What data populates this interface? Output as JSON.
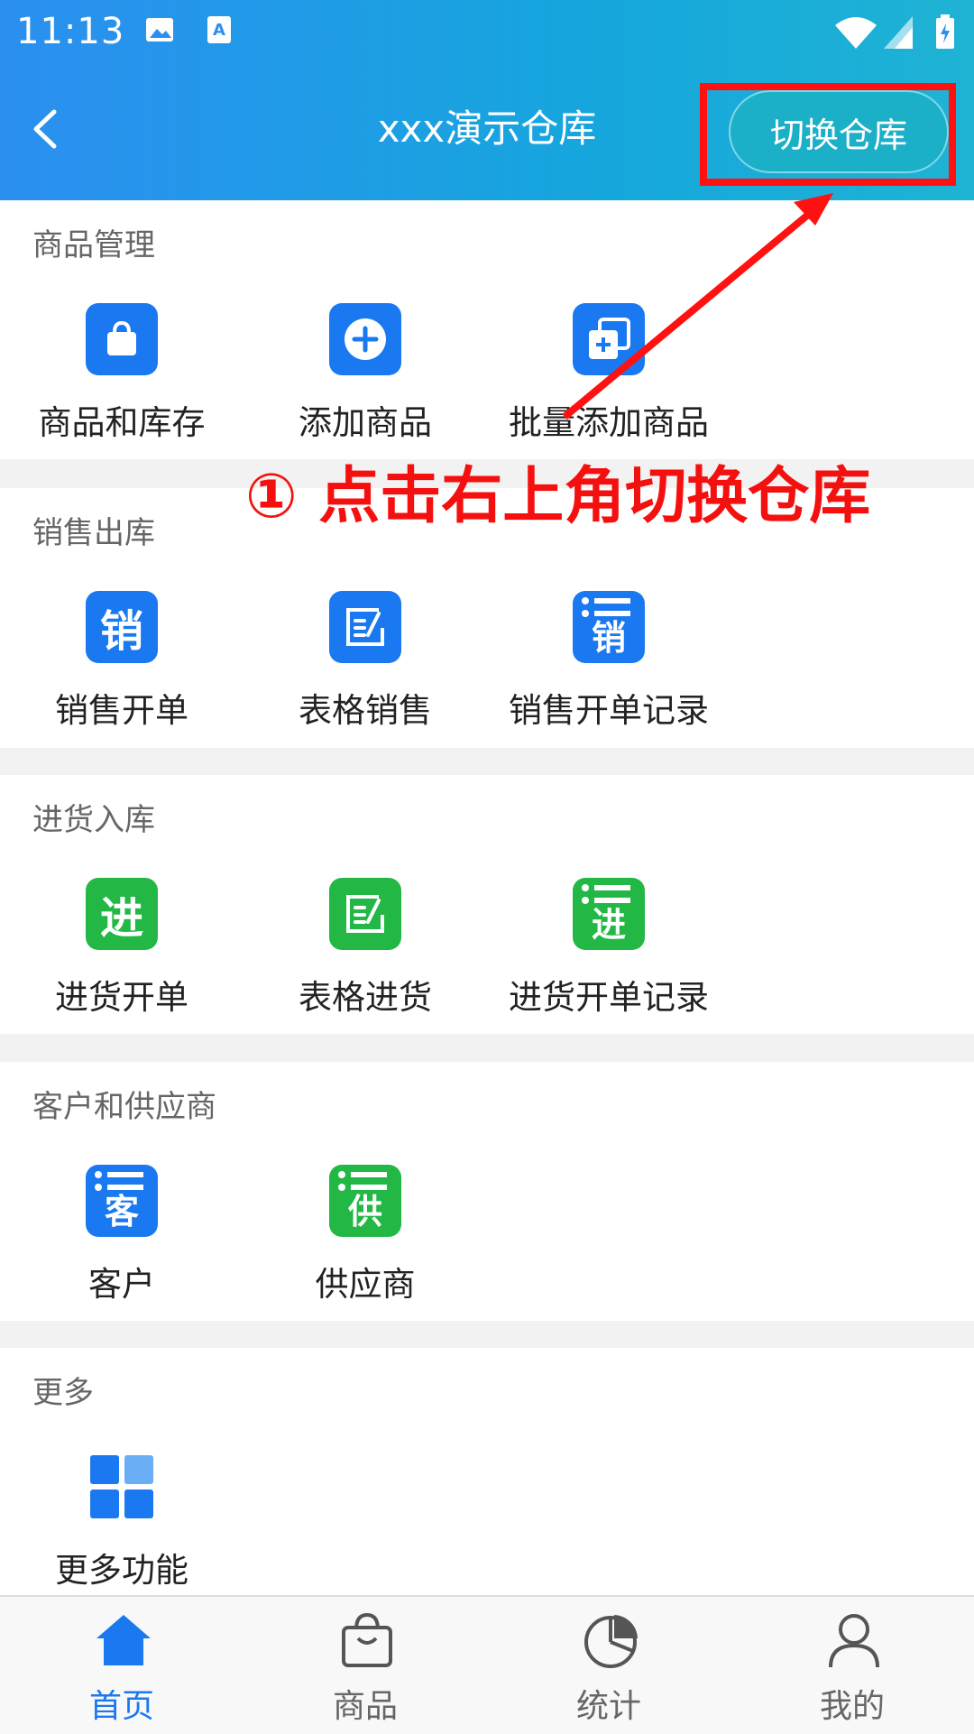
{
  "status_bar": {
    "time": "11:13"
  },
  "header": {
    "title": "xxx演示仓库",
    "switch_label": "切换仓库",
    "back_icon": "chevron-left-icon"
  },
  "annotation": {
    "text": "① 点击右上角切换仓库",
    "color": "#f51010"
  },
  "sections": {
    "goods": {
      "title": "商品管理",
      "items": [
        "商品和库存",
        "添加商品",
        "批量添加商品"
      ]
    },
    "sales": {
      "title": "销售出库",
      "items": [
        "销售开单",
        "表格销售",
        "销售开单记录"
      ],
      "glyph": "销"
    },
    "purchase": {
      "title": "进货入库",
      "items": [
        "进货开单",
        "表格进货",
        "进货开单记录"
      ],
      "glyph": "进"
    },
    "contacts": {
      "title": "客户和供应商",
      "items": [
        "客户",
        "供应商"
      ],
      "glyphs": [
        "客",
        "供"
      ]
    },
    "more": {
      "title": "更多",
      "items": [
        "更多功能"
      ]
    }
  },
  "tabbar": {
    "items": [
      "首页",
      "商品",
      "统计",
      "我的"
    ],
    "active": "首页"
  },
  "colors": {
    "accent_blue": "#1a79f0",
    "accent_green": "#23b845",
    "header_gradient": "#2b8ff0",
    "annotation_red": "#f11111"
  }
}
